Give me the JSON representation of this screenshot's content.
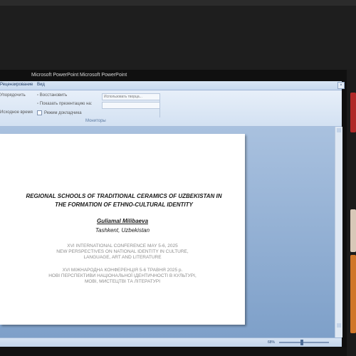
{
  "window": {
    "title_left": "Microsoft PowerPoint",
    "title_right": "Microsoft PowerPoint"
  },
  "ribbon": {
    "tabs": [
      "Рецензирование",
      "Вид"
    ],
    "items": {
      "arrange": "Упорядочить",
      "use_guides": "Использовать творца...",
      "restore": "Восстановить",
      "presenter_view": "Показать презентацию на:",
      "time": "Исходное время",
      "presenter_mode": "Режим докладчика"
    },
    "group_label": "Мониторы"
  },
  "slide": {
    "title_line1": "REGIONAL SCHOOLS OF TRADITIONAL CERAMICS OF UZBEKISTAN IN",
    "title_line2": "THE FORMATION OF ETHNO-CULTURAL IDENTITY",
    "author": "Guliamal Milibaeva",
    "city": "Tashkent, Uzbekistan",
    "conf_line1": "XVI INTERNATIONAL CONFERENCE MAY 5-6, 2025",
    "conf_line2": "NEW PERSPECTIVES ON NATIONAL IDENTITY IN CULTURE,",
    "conf_line3": "LANGUAGE, ART AND LITERATURE",
    "ua_line1": "XVI МІЖНАРОДНА КОНФЕРЕНЦІЯ 5-6 ТРАВНЯ 2025 р.",
    "ua_line2": "НОВІ ПЕРСПЕКТИВИ НАЦІОНАЛЬНОЇ ІДЕНТИЧНОСТІ В КУЛЬТУРІ,",
    "ua_line3": "МОВІ, МИСТЕЦТВІ ТА ЛІТЕРАТУРІ"
  },
  "status": {
    "zoom": "68%"
  },
  "colors": {
    "ribbon_bg": "#d3e1f2",
    "canvas_bg": "#7ea0c9",
    "thumb_1": "#b02828",
    "thumb_2": "#d8c8b8",
    "thumb_3": "#d0762a"
  }
}
